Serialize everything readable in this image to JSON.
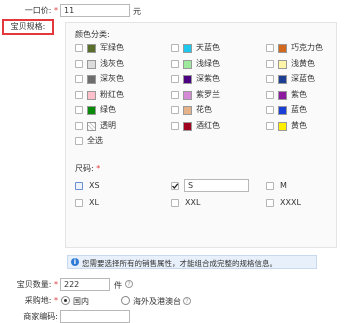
{
  "price": {
    "label": "一口价:",
    "required": "*",
    "value": "11",
    "unit": "元"
  },
  "spec_label": "宝贝规格:",
  "colors": {
    "title": "颜色分类:",
    "items": [
      {
        "name": "军绿色",
        "swatch": "#5a6e2b"
      },
      {
        "name": "天蓝色",
        "swatch": "#1ec7ee"
      },
      {
        "name": "巧克力色",
        "swatch": "#d2691e"
      },
      {
        "name": "浅灰色",
        "swatch": "#dcdcdc"
      },
      {
        "name": "浅绿色",
        "swatch": "#9ce89c"
      },
      {
        "name": "浅黄色",
        "swatch": "#fff5a8"
      },
      {
        "name": "深灰色",
        "swatch": "#6d6d6d"
      },
      {
        "name": "深紫色",
        "swatch": "#4b0082"
      },
      {
        "name": "深蓝色",
        "swatch": "#1c3f94"
      },
      {
        "name": "粉红色",
        "swatch": "#ffc0cb"
      },
      {
        "name": "紫罗兰",
        "swatch": "#d48ad4"
      },
      {
        "name": "紫色",
        "swatch": "#8b1a9e"
      },
      {
        "name": "绿色",
        "swatch": "#0a8a0a"
      },
      {
        "name": "花色",
        "swatch": "#e6b28a"
      },
      {
        "name": "蓝色",
        "swatch": "#1a3fd6"
      },
      {
        "name": "透明",
        "swatch": "pattern"
      },
      {
        "name": "酒红色",
        "swatch": "#a0001e"
      },
      {
        "name": "黄色",
        "swatch": "#ffee00"
      }
    ],
    "select_all": "全选"
  },
  "sizes": {
    "title": "尺码:",
    "required": "*",
    "items": [
      {
        "name": "XS",
        "checked": false
      },
      {
        "name": "S",
        "checked": true,
        "input_value": "S"
      },
      {
        "name": "M",
        "checked": false
      },
      {
        "name": "XL",
        "checked": false
      },
      {
        "name": "XXL",
        "checked": false
      },
      {
        "name": "XXXL",
        "checked": false
      }
    ]
  },
  "notice": "您需要选择所有的销售属性，才能组合成完整的规格信息。",
  "quantity": {
    "label": "宝贝数量:",
    "required": "*",
    "value": "222",
    "unit": "件"
  },
  "location": {
    "label": "采购地:",
    "required": "*",
    "options": [
      "国内",
      "海外及港澳台"
    ],
    "selected": 0
  },
  "merchant_code": {
    "label": "商家编码:",
    "value": ""
  },
  "colors_theme": {
    "accent_red": "#e4393c",
    "info_blue": "#2d7bd6"
  }
}
